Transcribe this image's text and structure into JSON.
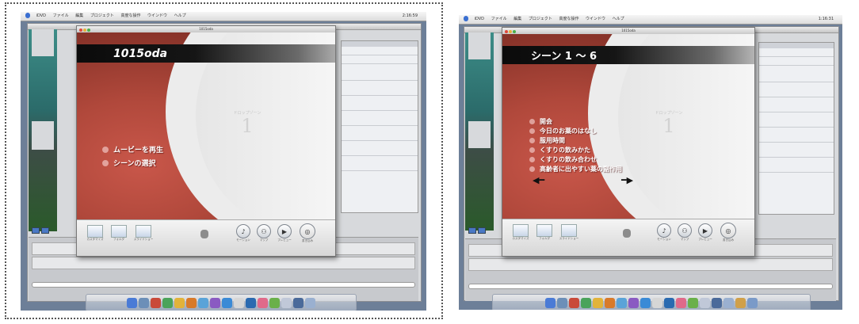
{
  "menubar": {
    "items": [
      "iDVD",
      "ファイル",
      "編集",
      "プロジェクト",
      "高度な操作",
      "ウインドウ",
      "ヘルプ"
    ],
    "clock_left": "2:16:59",
    "clock_right": "1:16:31"
  },
  "window_title": "1015oda",
  "dropzone": {
    "label": "ドロップゾーン",
    "number": "1"
  },
  "left": {
    "title": "1015oda",
    "menu_items": [
      "ムービーを再生",
      "シーンの選択"
    ]
  },
  "right": {
    "title": "シーン 1 〜 6",
    "menu_items": [
      "開会",
      "今日のお薬のはなし",
      "服用時間",
      "くすりの飲みかた",
      "くすりの飲み合わせ",
      "高齢者に出やすい薬の副作用"
    ],
    "prev_arrow": "◀━",
    "next_arrow": "━▶"
  },
  "controls": {
    "left_buttons": [
      "カスタマイズ",
      "フォルダ",
      "スライドショー"
    ],
    "right_buttons": [
      "モーション",
      "マップ",
      "プレビュー",
      "書き込み"
    ],
    "motion_glyph": "♪",
    "map_glyph": "⚇",
    "preview_glyph": "▶",
    "burn_glyph": "◎"
  },
  "colors": {
    "accent": "#b4483b",
    "title_bar": "#111111",
    "desktop": "#6d7f98"
  }
}
